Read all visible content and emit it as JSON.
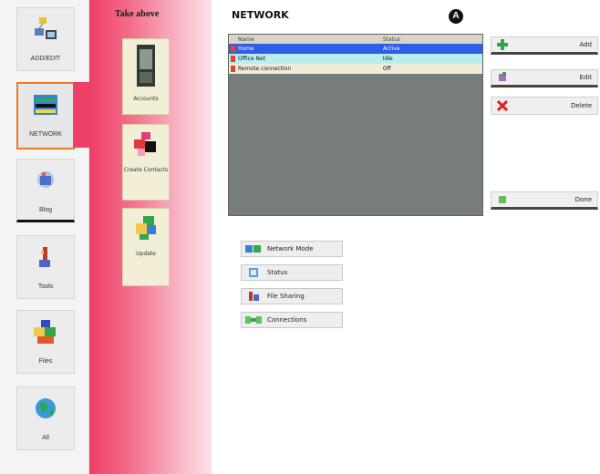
{
  "nav": {
    "items": [
      {
        "label": "ADD/EDIT",
        "icon": "network-users-icon"
      },
      {
        "label": "NETWORK",
        "icon": "network-list-icon"
      },
      {
        "label": "Blog",
        "icon": "blog-icon"
      },
      {
        "label": "Tools",
        "icon": "tools-icon"
      },
      {
        "label": "Files",
        "icon": "files-icon"
      },
      {
        "label": "All",
        "icon": "globe-icon"
      }
    ]
  },
  "subpanel": {
    "title": "Take above",
    "items": [
      {
        "label": "Accounts",
        "icon": "phone-icon"
      },
      {
        "label": "Create Contacts",
        "icon": "puzzle-icon"
      },
      {
        "label": "Update",
        "icon": "cubes-icon"
      }
    ]
  },
  "main": {
    "title": "NETWORK",
    "grid": {
      "headers": [
        "Name",
        "Status"
      ],
      "rows": [
        {
          "name": "Home",
          "status": "Active",
          "selected": true
        },
        {
          "name": "Office Net",
          "status": "Idle",
          "selected": false
        },
        {
          "name": "Remote connection",
          "status": "Off",
          "selected": false
        }
      ]
    },
    "badge": "A",
    "side_buttons": [
      {
        "label": "Add",
        "icon": "plus-icon"
      },
      {
        "label": "Edit",
        "icon": "edit-icon"
      },
      {
        "label": "Delete",
        "icon": "delete-icon"
      },
      {
        "label": "Done",
        "icon": "done-icon"
      }
    ],
    "actions": [
      {
        "label": "Network Mode",
        "icon": "network-mode-icon"
      },
      {
        "label": "Status",
        "icon": "status-icon"
      },
      {
        "label": "File Sharing",
        "icon": "file-sharing-icon"
      },
      {
        "label": "Connections",
        "icon": "connections-icon"
      }
    ]
  }
}
